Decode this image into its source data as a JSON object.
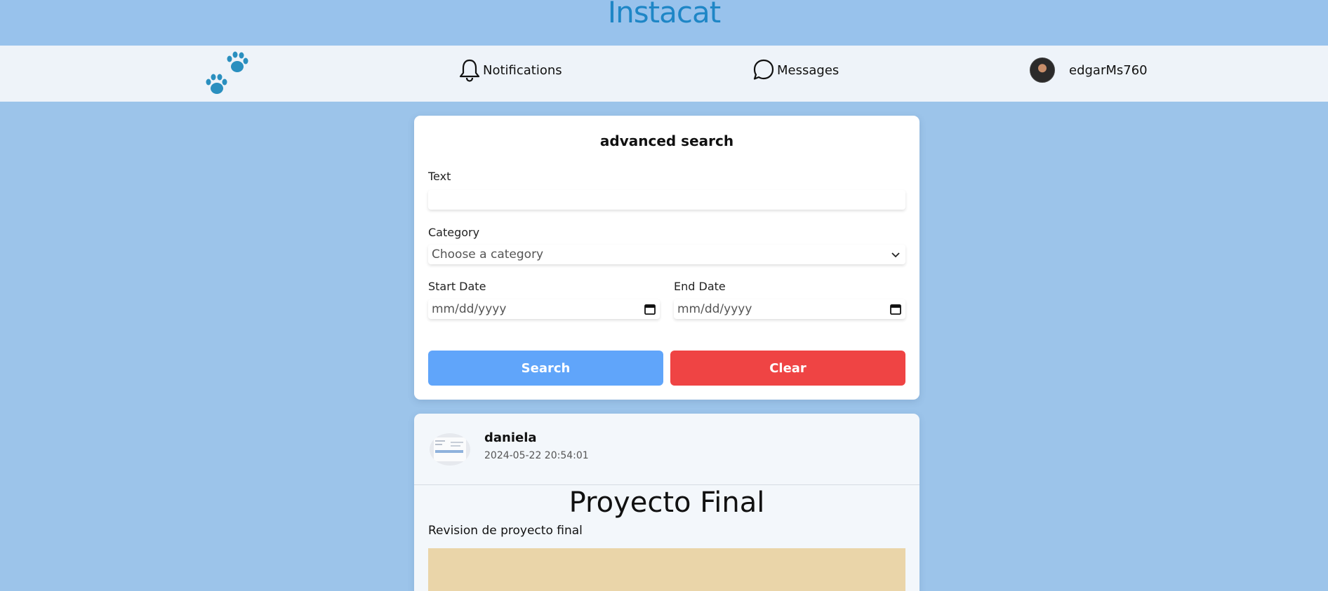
{
  "app": {
    "title": "Instacat"
  },
  "nav": {
    "notifications_label": "Notifications",
    "messages_label": "Messages",
    "username": "edgarMs760"
  },
  "search": {
    "title": "advanced search",
    "text_label": "Text",
    "text_value": "",
    "category_label": "Category",
    "category_selected": "Choose a category",
    "start_date_label": "Start Date",
    "start_date_placeholder": "mm/dd/yyyy",
    "end_date_label": "End Date",
    "end_date_placeholder": "mm/dd/yyyy",
    "search_button": "Search",
    "clear_button": "Clear"
  },
  "post": {
    "author": "daniela",
    "date": "2024-05-22 20:54:01",
    "title": "Proyecto Final",
    "description": "Revision de proyecto final"
  },
  "colors": {
    "background": "#9cc4ea",
    "brand": "#1e86c6",
    "search_button": "#60a5fa",
    "clear_button": "#ef4444",
    "paw": "#2a8fbf"
  },
  "icons": {
    "logo": "paw-icon",
    "notifications": "bell-icon",
    "messages": "chat-bubble-icon",
    "category": "chevron-down-icon",
    "date": "calendar-icon"
  }
}
